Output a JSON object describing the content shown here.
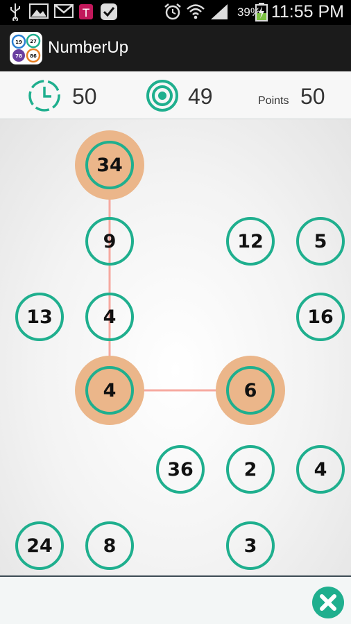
{
  "status_bar": {
    "battery_percent": "39%",
    "time": "11:55 PM",
    "icons": [
      "usb-icon",
      "image-icon",
      "gmail-icon",
      "tmobile-icon",
      "check-icon",
      "alarm-icon",
      "wifi-icon",
      "signal-icon",
      "battery-charging-icon"
    ]
  },
  "app": {
    "title": "NumberUp",
    "logo_numbers": [
      "19",
      "27",
      "78",
      "86"
    ]
  },
  "header": {
    "time_left": "50",
    "target": "49",
    "points_label": "Points",
    "points": "50"
  },
  "colors": {
    "accent": "#1faf8e",
    "selected_halo": "#ebb68a",
    "path_line": "#f6a9a0"
  },
  "board": {
    "bubbles": [
      {
        "value": "34",
        "selected": true
      },
      {
        "value": "9",
        "selected": false
      },
      {
        "value": "12",
        "selected": false
      },
      {
        "value": "5",
        "selected": false
      },
      {
        "value": "13",
        "selected": false
      },
      {
        "value": "4",
        "selected": false
      },
      {
        "value": "16",
        "selected": false
      },
      {
        "value": "4",
        "selected": true
      },
      {
        "value": "6",
        "selected": true
      },
      {
        "value": "36",
        "selected": false
      },
      {
        "value": "2",
        "selected": false
      },
      {
        "value": "4",
        "selected": false
      },
      {
        "value": "24",
        "selected": false
      },
      {
        "value": "8",
        "selected": false
      },
      {
        "value": "3",
        "selected": false
      }
    ]
  },
  "footer": {
    "close_icon": "close-icon"
  }
}
